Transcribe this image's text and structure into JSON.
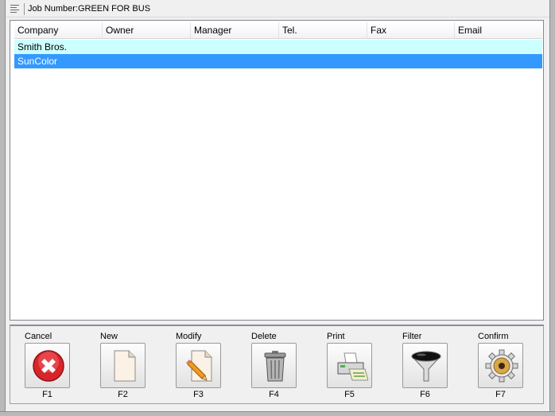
{
  "window": {
    "title": "Job Number:GREEN FOR BUS"
  },
  "grid": {
    "columns": [
      "Company",
      "Owner",
      "Manager",
      "Tel.",
      "Fax",
      "Email"
    ],
    "rows": [
      {
        "company": "Smith Bros.",
        "owner": "",
        "manager": "",
        "tel": "",
        "fax": "",
        "email": ""
      },
      {
        "company": "SunColor",
        "owner": "",
        "manager": "",
        "tel": "",
        "fax": "",
        "email": "",
        "selected": true
      }
    ]
  },
  "toolbar": {
    "buttons": [
      {
        "label": "Cancel",
        "key": "F1",
        "icon": "cancel-x-icon"
      },
      {
        "label": "New",
        "key": "F2",
        "icon": "new-document-icon"
      },
      {
        "label": "Modify",
        "key": "F3",
        "icon": "edit-pencil-icon"
      },
      {
        "label": "Delete",
        "key": "F4",
        "icon": "trash-can-icon"
      },
      {
        "label": "Print",
        "key": "F5",
        "icon": "printer-icon"
      },
      {
        "label": "Filter",
        "key": "F6",
        "icon": "funnel-icon"
      },
      {
        "label": "Confirm",
        "key": "F7",
        "icon": "gear-icon"
      }
    ]
  },
  "colors": {
    "selected_row": "#3399ff",
    "alt_row": "#ccffff",
    "cancel_red": "#d9242a"
  }
}
